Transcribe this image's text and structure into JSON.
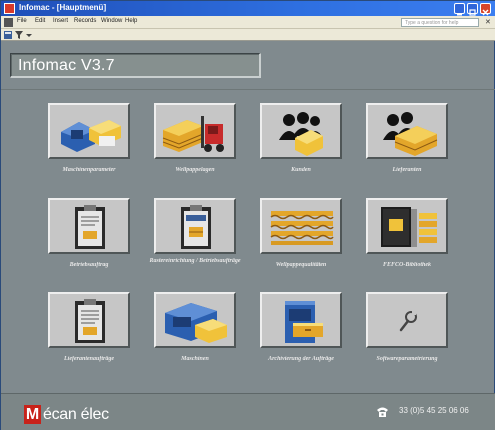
{
  "window": {
    "title": "Infomac - [Hauptmenü]",
    "icons": {
      "app": "app-icon",
      "minimize": "minimize-icon",
      "maximize": "maximize-icon",
      "close": "close-icon"
    }
  },
  "menubar": {
    "items": [
      "File",
      "Edit",
      "Insert",
      "Records",
      "Window",
      "Help"
    ],
    "help_placeholder": "Type a question for help"
  },
  "app": {
    "title": "Infomac V3.7"
  },
  "tiles": [
    {
      "label": "Maschinenparameter",
      "icon": "machine-parameters-icon"
    },
    {
      "label": "Wellpappelagen",
      "icon": "forklift-icon"
    },
    {
      "label": "Kunden",
      "icon": "customers-icon"
    },
    {
      "label": "Lieferanten",
      "icon": "suppliers-icon"
    },
    {
      "label": "Betriebsauftrag",
      "icon": "clipboard-order-icon"
    },
    {
      "label": "Rastereinrichtung / Betriebsaufträge",
      "icon": "clipboard-grid-icon"
    },
    {
      "label": "Wellpappequalitäten",
      "icon": "corrugated-layers-icon"
    },
    {
      "label": "FEFCO-Bibliothek",
      "icon": "book-library-icon"
    },
    {
      "label": "Lieferantenaufträge",
      "icon": "clipboard-supplier-icon"
    },
    {
      "label": "Maschinen",
      "icon": "machine-icon"
    },
    {
      "label": "Archivierung der Aufträge",
      "icon": "archive-cabinet-icon"
    },
    {
      "label": "Softwareparametrierung",
      "icon": "wrench-icon"
    }
  ],
  "footer": {
    "logo_initial": "M",
    "logo_rest": "écan élec",
    "phone": "33 (0)5 45 25 06 06",
    "phone_icon": "phone-icon"
  },
  "colors": {
    "background": "#808a8e",
    "tile": "#c6c6c6",
    "brand_red": "#c8221a",
    "titlebar": "#2e6fe0"
  }
}
